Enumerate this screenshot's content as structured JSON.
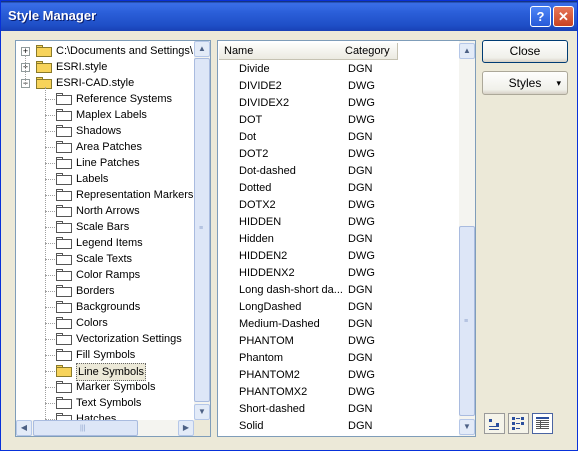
{
  "window": {
    "title": "Style Manager"
  },
  "titlebar": {
    "help_glyph": "?",
    "close_glyph": "✕"
  },
  "tree": {
    "items": [
      {
        "label": "C:\\Documents and Settings\\",
        "expander": "+",
        "folder": "yellow"
      },
      {
        "label": "ESRI.style",
        "expander": "+",
        "folder": "yellow"
      },
      {
        "label": "ESRI-CAD.style",
        "expander": "−",
        "folder": "yellow"
      },
      {
        "label": "Reference Systems",
        "folder": "white"
      },
      {
        "label": "Maplex Labels",
        "folder": "white"
      },
      {
        "label": "Shadows",
        "folder": "white"
      },
      {
        "label": "Area Patches",
        "folder": "white"
      },
      {
        "label": "Line Patches",
        "folder": "white"
      },
      {
        "label": "Labels",
        "folder": "white"
      },
      {
        "label": "Representation Markers",
        "folder": "white"
      },
      {
        "label": "North Arrows",
        "folder": "white"
      },
      {
        "label": "Scale Bars",
        "folder": "white"
      },
      {
        "label": "Legend Items",
        "folder": "white"
      },
      {
        "label": "Scale Texts",
        "folder": "white"
      },
      {
        "label": "Color Ramps",
        "folder": "white"
      },
      {
        "label": "Borders",
        "folder": "white"
      },
      {
        "label": "Backgrounds",
        "folder": "white"
      },
      {
        "label": "Colors",
        "folder": "white"
      },
      {
        "label": "Vectorization Settings",
        "folder": "white"
      },
      {
        "label": "Fill Symbols",
        "folder": "white"
      },
      {
        "label": "Line Symbols",
        "folder": "yellow",
        "selected": true
      },
      {
        "label": "Marker Symbols",
        "folder": "white"
      },
      {
        "label": "Text Symbols",
        "folder": "white"
      },
      {
        "label": "Hatches",
        "folder": "white"
      }
    ]
  },
  "list": {
    "columns": {
      "name": "Name",
      "category": "Category"
    },
    "rows": [
      {
        "name": "Divide",
        "category": "DGN",
        "pattern": "dashdot"
      },
      {
        "name": "DIVIDE2",
        "category": "DWG",
        "pattern": "dashdotdot"
      },
      {
        "name": "DIVIDEX2",
        "category": "DWG",
        "pattern": "dashdot"
      },
      {
        "name": "DOT",
        "category": "DWG",
        "pattern": "dots-wide"
      },
      {
        "name": "Dot",
        "category": "DGN",
        "pattern": "dots-wide"
      },
      {
        "name": "DOT2",
        "category": "DWG",
        "pattern": "dots-fine"
      },
      {
        "name": "Dot-dashed",
        "category": "DGN",
        "pattern": "solid"
      },
      {
        "name": "Dotted",
        "category": "DGN",
        "pattern": "dashed-short"
      },
      {
        "name": "DOTX2",
        "category": "DWG",
        "pattern": "dashed-sparse"
      },
      {
        "name": "HIDDEN",
        "category": "DWG",
        "pattern": "dashed-short"
      },
      {
        "name": "Hidden",
        "category": "DGN",
        "pattern": "dashed-medium"
      },
      {
        "name": "HIDDEN2",
        "category": "DWG",
        "pattern": "dashed-fine"
      },
      {
        "name": "HIDDENX2",
        "category": "DWG",
        "pattern": "dashed-long"
      },
      {
        "name": "Long dash-short da...",
        "category": "DGN",
        "pattern": "solid"
      },
      {
        "name": "LongDashed",
        "category": "DGN",
        "pattern": "dashed-long"
      },
      {
        "name": "Medium-Dashed",
        "category": "DGN",
        "pattern": "dashed-medium"
      },
      {
        "name": "PHANTOM",
        "category": "DWG",
        "pattern": "dashdot"
      },
      {
        "name": "Phantom",
        "category": "DGN",
        "pattern": "dashdot"
      },
      {
        "name": "PHANTOM2",
        "category": "DWG",
        "pattern": "dashed-fine"
      },
      {
        "name": "PHANTOMX2",
        "category": "DWG",
        "pattern": "dashdotdot"
      },
      {
        "name": "Short-dashed",
        "category": "DGN",
        "pattern": "dashed-short"
      },
      {
        "name": "Solid",
        "category": "DGN",
        "pattern": "solid"
      }
    ]
  },
  "buttons": {
    "close_label": "Close",
    "styles_label": "Styles",
    "styles_arrow": "▾"
  },
  "views": [
    {
      "icon": "small-icons-icon",
      "active": false
    },
    {
      "icon": "list-view-icon",
      "active": false
    },
    {
      "icon": "details-view-icon",
      "active": true
    }
  ],
  "colors": {
    "titlebar": "#2a5ed8",
    "selection": "#ece9d8",
    "border": "#7f9db9"
  }
}
